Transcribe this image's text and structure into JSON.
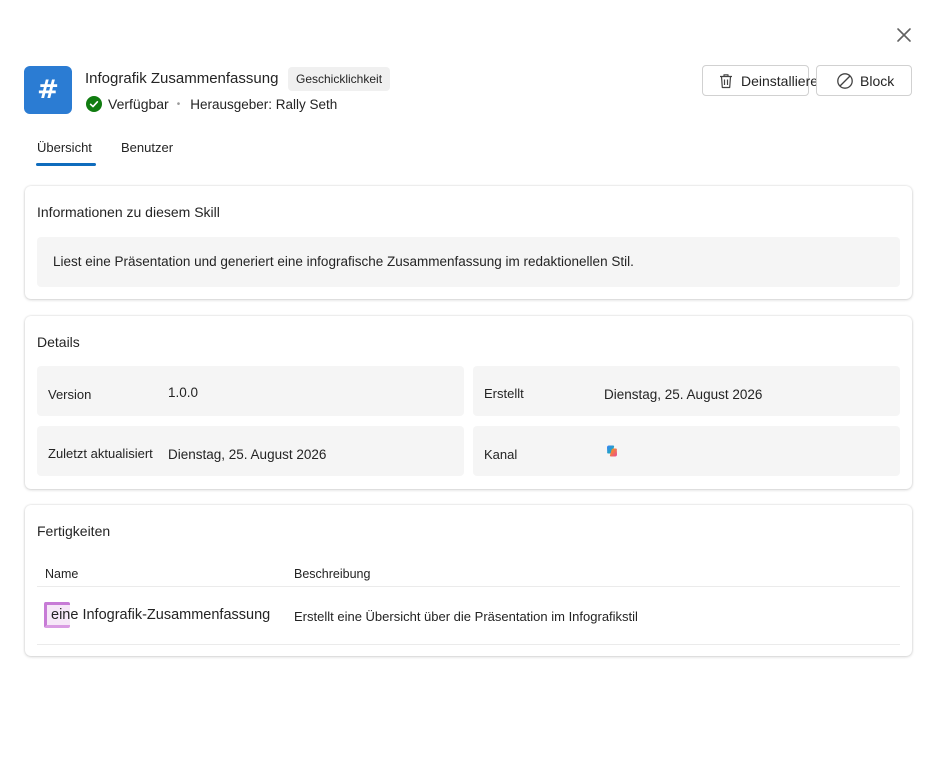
{
  "dialog": {
    "close_icon": "close-icon"
  },
  "header": {
    "app_icon_glyph": "#",
    "app_icon_color": "#2b7cd3",
    "title": "Infografik Zusammenfassung",
    "type_badge": "Geschicklichkeit",
    "status": "Verfügbar",
    "status_color": "#107c10",
    "publisher": "Herausgeber: Rally Seth",
    "buttons": {
      "uninstall": {
        "label": "Deinstallieren",
        "icon": "trash-icon"
      },
      "block": {
        "label": "Block",
        "icon": "block-icon"
      }
    }
  },
  "tabs": [
    {
      "label": "Übersicht",
      "selected": true
    },
    {
      "label": "Benutzer",
      "selected": false
    }
  ],
  "about": {
    "title": "Informationen zu diesem Skill",
    "description": "Liest eine Präsentation und generiert eine infografische Zusammenfassung im redaktionellen Stil."
  },
  "details": {
    "title": "Details",
    "version_label": "Version",
    "version_value": "1.0.0",
    "created_label": "Erstellt",
    "created_value": "Dienstag, 25. August 2026",
    "updated_label": "Zuletzt aktualisiert",
    "updated_value": "Dienstag, 25. August 2026",
    "channel_label": "Kanal",
    "channel_icon": "copilot-icon"
  },
  "skills": {
    "title": "Fertigkeiten",
    "columns": {
      "name": "Name",
      "description": "Beschreibung"
    },
    "rows": [
      {
        "name": "eine Infografik-Zusammenfassung",
        "description": "Erstellt eine Übersicht über die Präsentation im Infografikstil",
        "icon": "skill-icon"
      }
    ]
  },
  "colors": {
    "accent": "#0f6cbd",
    "field_background": "#f5f5f5"
  }
}
